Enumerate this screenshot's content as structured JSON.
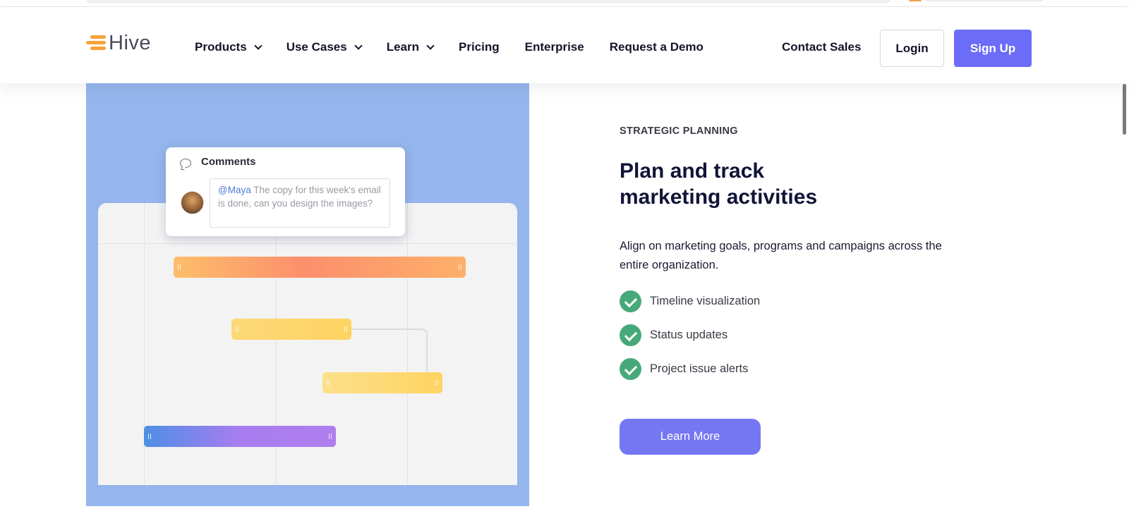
{
  "navbar": {
    "logo_text": "Hive",
    "links": [
      {
        "label": "Products",
        "has_dropdown": true
      },
      {
        "label": "Use Cases",
        "has_dropdown": true
      },
      {
        "label": "Learn",
        "has_dropdown": true
      },
      {
        "label": "Pricing",
        "has_dropdown": false
      },
      {
        "label": "Enterprise",
        "has_dropdown": false
      },
      {
        "label": "Request a Demo",
        "has_dropdown": false
      }
    ],
    "contact_sales": "Contact Sales",
    "login_label": "Login",
    "signup_label": "Sign Up"
  },
  "illustration": {
    "comments_title": "Comments",
    "mention": "@Maya",
    "comment_text": " The copy for this week's email is done, can you design the images?"
  },
  "feature_section": {
    "eyebrow": "STRATEGIC PLANNING",
    "heading_line1": "Plan and track",
    "heading_line2": "marketing activities",
    "description": "Align on marketing goals, programs and campaigns across the entire organization.",
    "features": [
      {
        "label": "Timeline visualization"
      },
      {
        "label": "Status updates"
      },
      {
        "label": "Project issue alerts"
      }
    ],
    "cta_label": "Learn More"
  },
  "colors": {
    "brand_orange": "#f6a33b",
    "primary_button": "#6b6cf7",
    "cta_button": "#7477f2",
    "check_green": "#47a97a",
    "illustration_bg": "#95b6ec",
    "heading_navy": "#111437"
  },
  "icons": {
    "logo": "hive-logo-icon",
    "dropdown": "chevron-down-icon",
    "comment": "comment-bubble-icon",
    "check": "check-circle-icon"
  }
}
